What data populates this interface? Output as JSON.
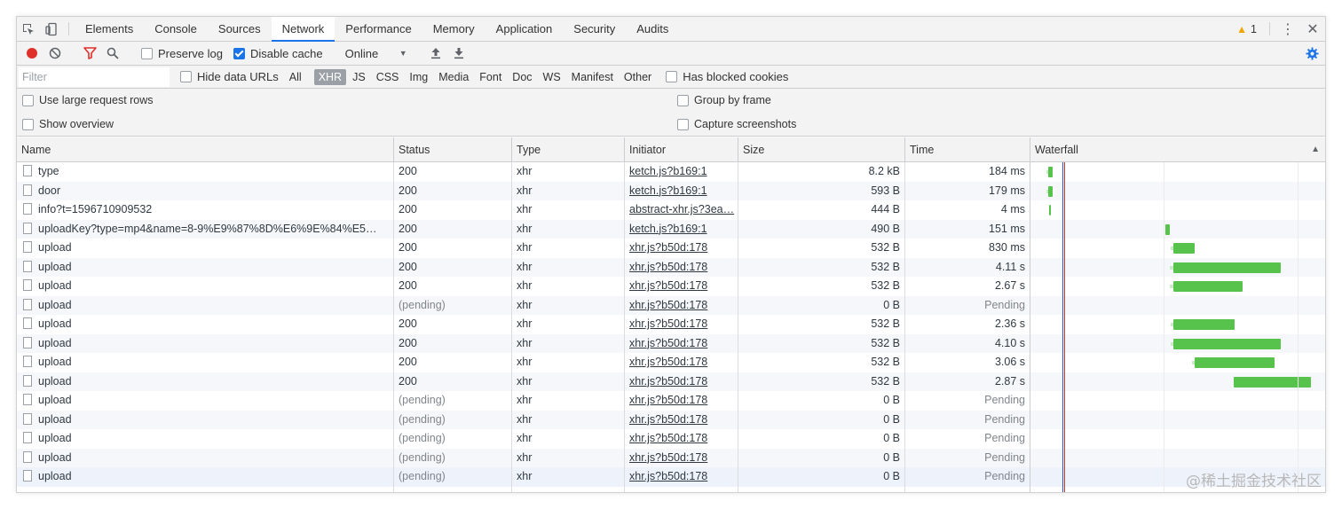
{
  "tabs": [
    {
      "label": "Elements"
    },
    {
      "label": "Console"
    },
    {
      "label": "Sources"
    },
    {
      "label": "Network",
      "active": true
    },
    {
      "label": "Performance"
    },
    {
      "label": "Memory"
    },
    {
      "label": "Application"
    },
    {
      "label": "Security"
    },
    {
      "label": "Audits"
    }
  ],
  "warnings": {
    "count": "1",
    "icon": "warning-triangle-icon",
    "color": "#f2a600"
  },
  "toolbar": {
    "preserve_log": "Preserve log",
    "disable_cache": "Disable cache",
    "throttling": "Online",
    "record_color": "#e0302a"
  },
  "filterbar": {
    "placeholder": "Filter",
    "hide_data_urls": "Hide data URLs",
    "types": [
      "All",
      "XHR",
      "JS",
      "CSS",
      "Img",
      "Media",
      "Font",
      "Doc",
      "WS",
      "Manifest",
      "Other"
    ],
    "active_type": "XHR",
    "has_blocked_cookies": "Has blocked cookies"
  },
  "settings": {
    "large_rows": "Use large request rows",
    "show_overview": "Show overview",
    "group_by_frame": "Group by frame",
    "capture_screenshots": "Capture screenshots"
  },
  "columns": [
    "Name",
    "Status",
    "Type",
    "Initiator",
    "Size",
    "Time",
    "Waterfall"
  ],
  "rows": [
    {
      "name": "type",
      "status": "200",
      "type": "xhr",
      "initiator": "ketch.js?b169:1",
      "size": "8.2 kB",
      "time": "184 ms"
    },
    {
      "name": "door",
      "status": "200",
      "type": "xhr",
      "initiator": "ketch.js?b169:1",
      "size": "593 B",
      "time": "179 ms"
    },
    {
      "name": "info?t=1596710909532",
      "status": "200",
      "type": "xhr",
      "initiator": "abstract-xhr.js?3ea…",
      "size": "444 B",
      "time": "4 ms"
    },
    {
      "name": "uploadKey?type=mp4&name=8-9%E9%87%8D%E6%9E%84%E5…",
      "status": "200",
      "type": "xhr",
      "initiator": "ketch.js?b169:1",
      "size": "490 B",
      "time": "151 ms"
    },
    {
      "name": "upload",
      "status": "200",
      "type": "xhr",
      "initiator": "xhr.js?b50d:178",
      "size": "532 B",
      "time": "830 ms"
    },
    {
      "name": "upload",
      "status": "200",
      "type": "xhr",
      "initiator": "xhr.js?b50d:178",
      "size": "532 B",
      "time": "4.11 s"
    },
    {
      "name": "upload",
      "status": "200",
      "type": "xhr",
      "initiator": "xhr.js?b50d:178",
      "size": "532 B",
      "time": "2.67 s"
    },
    {
      "name": "upload",
      "status": "(pending)",
      "type": "xhr",
      "initiator": "xhr.js?b50d:178",
      "size": "0 B",
      "time": "Pending"
    },
    {
      "name": "upload",
      "status": "200",
      "type": "xhr",
      "initiator": "xhr.js?b50d:178",
      "size": "532 B",
      "time": "2.36 s"
    },
    {
      "name": "upload",
      "status": "200",
      "type": "xhr",
      "initiator": "xhr.js?b50d:178",
      "size": "532 B",
      "time": "4.10 s"
    },
    {
      "name": "upload",
      "status": "200",
      "type": "xhr",
      "initiator": "xhr.js?b50d:178",
      "size": "532 B",
      "time": "3.06 s"
    },
    {
      "name": "upload",
      "status": "200",
      "type": "xhr",
      "initiator": "xhr.js?b50d:178",
      "size": "532 B",
      "time": "2.87 s"
    },
    {
      "name": "upload",
      "status": "(pending)",
      "type": "xhr",
      "initiator": "xhr.js?b50d:178",
      "size": "0 B",
      "time": "Pending"
    },
    {
      "name": "upload",
      "status": "(pending)",
      "type": "xhr",
      "initiator": "xhr.js?b50d:178",
      "size": "0 B",
      "time": "Pending"
    },
    {
      "name": "upload",
      "status": "(pending)",
      "type": "xhr",
      "initiator": "xhr.js?b50d:178",
      "size": "0 B",
      "time": "Pending"
    },
    {
      "name": "upload",
      "status": "(pending)",
      "type": "xhr",
      "initiator": "xhr.js?b50d:178",
      "size": "0 B",
      "time": "Pending"
    },
    {
      "name": "upload",
      "status": "(pending)",
      "type": "xhr",
      "initiator": "xhr.js?b50d:178",
      "size": "0 B",
      "time": "Pending"
    }
  ],
  "watermark": "@稀土掘金技术社区"
}
